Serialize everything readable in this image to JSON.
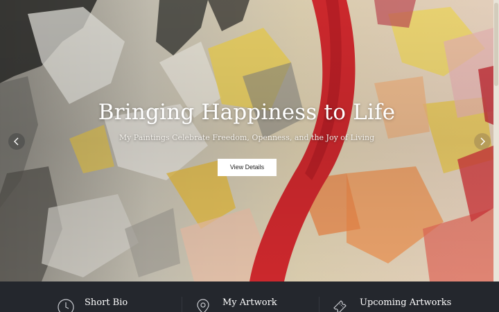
{
  "slider": {
    "title": "Bringing Happiness to Life",
    "subtitle": "My Paintings Celebrate Freedom, Openness, and the Joy of Living",
    "button_label": "View Details",
    "prev_icon": "chevron-left-icon",
    "next_icon": "chevron-right-icon"
  },
  "features": [
    {
      "label": "Short Bio",
      "icon": "clock-icon"
    },
    {
      "label": "My Artwork",
      "icon": "location-pin-icon"
    },
    {
      "label": "Upcoming Artworks",
      "icon": "ticket-icon"
    }
  ],
  "colors": {
    "footer_bg": "#24272d",
    "accent_red": "#d42a2e",
    "button_bg": "#ffffff"
  }
}
